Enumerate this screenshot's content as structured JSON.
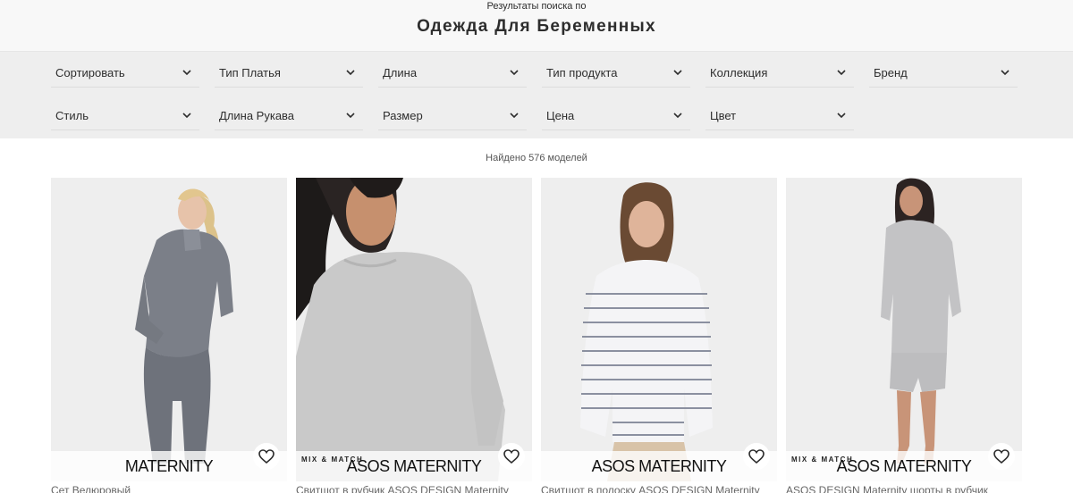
{
  "header": {
    "subtitle": "Результаты поиска по",
    "title": "Одежда Для Беременных"
  },
  "filters": [
    {
      "label": "Сортировать"
    },
    {
      "label": "Тип Платья"
    },
    {
      "label": "Длина"
    },
    {
      "label": "Тип продукта"
    },
    {
      "label": "Коллекция"
    },
    {
      "label": "Бренд"
    },
    {
      "label": "Стиль"
    },
    {
      "label": "Длина Рукава"
    },
    {
      "label": "Размер"
    },
    {
      "label": "Цена"
    },
    {
      "label": "Цвет"
    }
  ],
  "results": {
    "count_text": "Найдено 576 моделей"
  },
  "products": [
    {
      "brand": "MATERNITY",
      "tag": "",
      "caption": "Сет Велюровый"
    },
    {
      "brand": "ASOS MATERNITY",
      "tag": "MIX & MATCH",
      "caption": "Свитшот в рубчик ASOS DESIGN Maternity"
    },
    {
      "brand": "ASOS MATERNITY",
      "tag": "",
      "caption": "Свитшот в полоску ASOS DESIGN Maternity"
    },
    {
      "brand": "ASOS MATERNITY",
      "tag": "MIX & MATCH",
      "caption": "ASOS DESIGN Maternity шорты в рубчик"
    }
  ],
  "colors": {
    "header_bg": "#f8f8f8",
    "filter_bg": "#eeeeee",
    "text": "#2d2d2d"
  },
  "icons": {
    "dropdown": "chevron-down-icon",
    "save": "heart-icon"
  }
}
